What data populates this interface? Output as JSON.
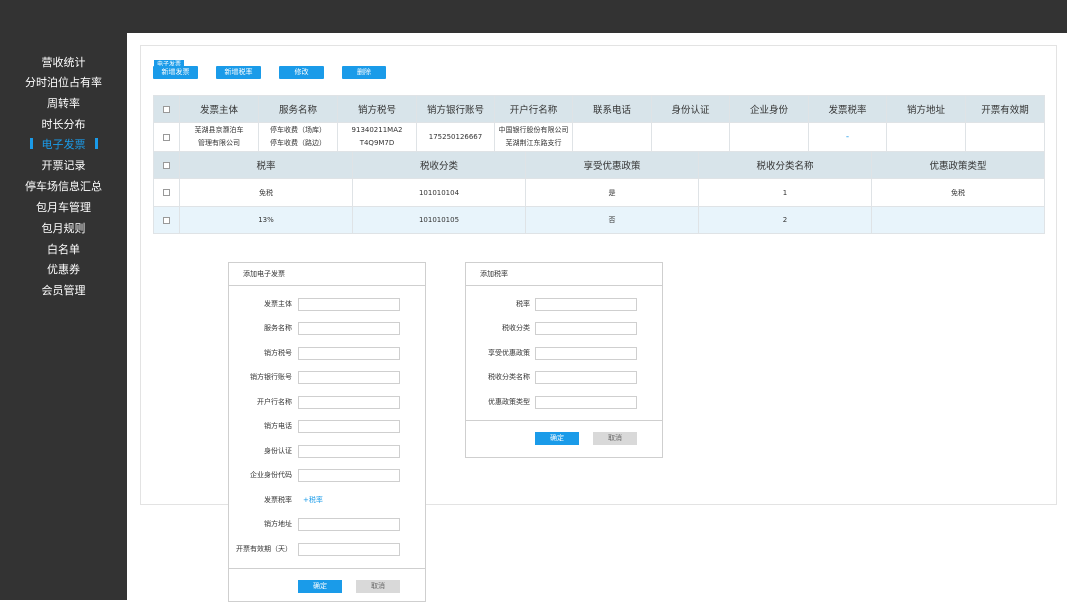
{
  "sidebar": {
    "items": [
      {
        "label": "营收统计"
      },
      {
        "label": "分时泊位占有率"
      },
      {
        "label": "周转率"
      },
      {
        "label": "时长分布"
      },
      {
        "label": "电子发票",
        "active": true
      },
      {
        "label": "开票记录"
      },
      {
        "label": "停车场信息汇总"
      },
      {
        "label": "包月车管理"
      },
      {
        "label": "包月规则"
      },
      {
        "label": "白名单"
      },
      {
        "label": "优惠券"
      },
      {
        "label": "会员管理"
      }
    ]
  },
  "section_title": "电子发票",
  "toolbar": {
    "add_invoice": "新增发票",
    "add_tax_rate": "新增税率",
    "edit": "修改",
    "delete": "删除"
  },
  "invoice_table": {
    "headers": [
      "发票主体",
      "服务名称",
      "销方税号",
      "销方银行账号",
      "开户行名称",
      "联系电话",
      "身份认证",
      "企业身份",
      "发票税率",
      "销方地址",
      "开票有效期"
    ],
    "row": {
      "subject": [
        "芜湖县京灏泊车",
        "管理有限公司"
      ],
      "service": [
        "停车收费（场库）",
        "停车收费（路边）"
      ],
      "tax_no": [
        "91340211MA2",
        "T4Q9M7D"
      ],
      "bank_account": "175250126667",
      "bank_name": [
        "中国银行股份有限公司",
        "芜湖荆江东路支行"
      ],
      "phone": "",
      "identity_auth": "",
      "enterprise_identity": "",
      "tax_rate": "-",
      "address": "",
      "validity": ""
    }
  },
  "tax_table": {
    "headers": [
      "税率",
      "税收分类",
      "享受优惠政策",
      "税收分类名称",
      "优惠政策类型"
    ],
    "rows": [
      {
        "rate": "免税",
        "category": "101010104",
        "preferential": "是",
        "category_name": "1",
        "policy_type": "免税"
      },
      {
        "rate": "13%",
        "category": "101010105",
        "preferential": "否",
        "category_name": "2",
        "policy_type": ""
      }
    ]
  },
  "invoice_dialog": {
    "title": "添加电子发票",
    "fields": [
      "发票主体",
      "服务名称",
      "销方税号",
      "销方银行账号",
      "开户行名称",
      "销方电话",
      "身份认证",
      "企业身份代码",
      "发票税率",
      "销方地址",
      "开票有效期（天）"
    ],
    "add_rate_link": "+税率",
    "ok": "确定",
    "cancel": "取消"
  },
  "rate_dialog": {
    "title": "添加税率",
    "fields": [
      "税率",
      "税收分类",
      "享受优惠政策",
      "税收分类名称",
      "优惠政策类型"
    ],
    "ok": "确定",
    "cancel": "取消"
  },
  "colors": {
    "sidebar_bg": "#333333",
    "accent": "#1a9be9",
    "header_bg": "#d8e4ea",
    "row_highlight": "#e8f4fb"
  }
}
